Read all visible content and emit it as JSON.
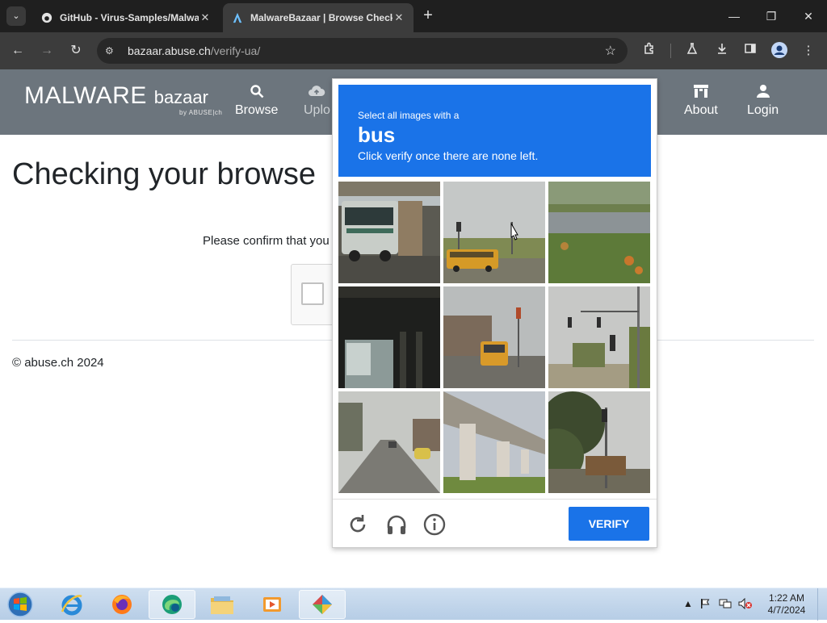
{
  "browser": {
    "tabs": [
      {
        "title": "GitHub - Virus-Samples/Malwa",
        "favicon": "github-icon",
        "active": false
      },
      {
        "title": "MalwareBazaar | Browse Check",
        "favicon": "malwarebazaar-icon",
        "active": true
      }
    ],
    "url_host": "bazaar.abuse.ch",
    "url_path": "/verify-ua/"
  },
  "site": {
    "logo_main": "MALWARE",
    "logo_sub": "bazaar",
    "logo_by": "by ABUSE|ch",
    "nav": [
      {
        "label": "Browse",
        "icon": "search-icon"
      },
      {
        "label": "Uplo",
        "icon": "cloud-upload-icon"
      },
      {
        "label": "About",
        "icon": "building-icon"
      },
      {
        "label": "Login",
        "icon": "user-icon"
      }
    ]
  },
  "page": {
    "title": "Checking your browse",
    "confirm_text": "Please confirm that you",
    "footer": "© abuse.ch 2024"
  },
  "captcha": {
    "instruction_line1": "Select all images with a",
    "target_word": "bus",
    "instruction_line3": "Click verify once there are none left.",
    "verify_label": "VERIFY",
    "accent_color": "#1a73e8",
    "tiles": [
      "bus-side",
      "school-bus-road",
      "grass-field",
      "underpass-dark",
      "school-bus-street",
      "traffic-light",
      "road-car",
      "overpass-pillars",
      "tree-traffic-light"
    ]
  },
  "taskbar": {
    "apps": [
      "internet-explorer-icon",
      "firefox-icon",
      "edge-icon",
      "folder-icon",
      "media-player-icon",
      "paint-icon"
    ],
    "time": "1:22 AM",
    "date": "4/7/2024"
  }
}
